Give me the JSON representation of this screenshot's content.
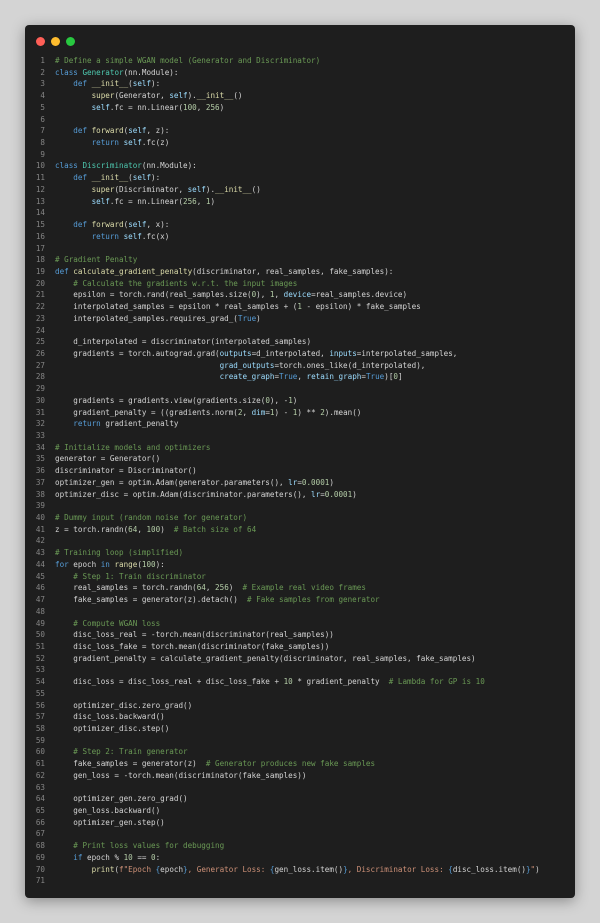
{
  "editor": {
    "colors": {
      "background": "#1e1e1e",
      "keyword": "#569cd6",
      "function": "#dcdcaa",
      "class": "#4ec9b0",
      "self": "#9cdcfe",
      "number": "#b5cea8",
      "string": "#ce9178",
      "comment": "#6a9955",
      "line_number": "#858585",
      "close_dot": "#ff5f57",
      "minimize_dot": "#febc2e",
      "maximize_dot": "#28c840"
    },
    "lines": [
      {
        "n": "1",
        "t": [
          [
            "cm",
            "# Define a simple WGAN model (Generator and Discriminator)"
          ]
        ]
      },
      {
        "n": "2",
        "t": [
          [
            "kw",
            "class "
          ],
          [
            "cls",
            "Generator"
          ],
          [
            "",
            "(nn.Module):"
          ]
        ]
      },
      {
        "n": "3",
        "t": [
          [
            "",
            "    "
          ],
          [
            "kw",
            "def "
          ],
          [
            "fn",
            "__init__"
          ],
          [
            "",
            "("
          ],
          [
            "self",
            "self"
          ],
          [
            "",
            "):"
          ]
        ]
      },
      {
        "n": "4",
        "t": [
          [
            "",
            "        "
          ],
          [
            "fn",
            "super"
          ],
          [
            "",
            "(Generator, "
          ],
          [
            "self",
            "self"
          ],
          [
            "",
            ")."
          ],
          [
            "fn",
            "__init__"
          ],
          [
            "",
            "()"
          ]
        ]
      },
      {
        "n": "5",
        "t": [
          [
            "",
            "        "
          ],
          [
            "self",
            "self"
          ],
          [
            "",
            ".fc = nn.Linear("
          ],
          [
            "num",
            "100"
          ],
          [
            "",
            ", "
          ],
          [
            "num",
            "256"
          ],
          [
            "",
            ")"
          ]
        ]
      },
      {
        "n": "6",
        "t": []
      },
      {
        "n": "7",
        "t": [
          [
            "",
            "    "
          ],
          [
            "kw",
            "def "
          ],
          [
            "fn",
            "forward"
          ],
          [
            "",
            "("
          ],
          [
            "self",
            "self"
          ],
          [
            "",
            ", z):"
          ]
        ]
      },
      {
        "n": "8",
        "t": [
          [
            "",
            "        "
          ],
          [
            "kw",
            "return "
          ],
          [
            "self",
            "self"
          ],
          [
            "",
            ".fc(z)"
          ]
        ]
      },
      {
        "n": "9",
        "t": []
      },
      {
        "n": "10",
        "t": [
          [
            "kw",
            "class "
          ],
          [
            "cls",
            "Discriminator"
          ],
          [
            "",
            "(nn.Module):"
          ]
        ]
      },
      {
        "n": "11",
        "t": [
          [
            "",
            "    "
          ],
          [
            "kw",
            "def "
          ],
          [
            "fn",
            "__init__"
          ],
          [
            "",
            "("
          ],
          [
            "self",
            "self"
          ],
          [
            "",
            "):"
          ]
        ]
      },
      {
        "n": "12",
        "t": [
          [
            "",
            "        "
          ],
          [
            "fn",
            "super"
          ],
          [
            "",
            "(Discriminator, "
          ],
          [
            "self",
            "self"
          ],
          [
            "",
            ")."
          ],
          [
            "fn",
            "__init__"
          ],
          [
            "",
            "()"
          ]
        ]
      },
      {
        "n": "13",
        "t": [
          [
            "",
            "        "
          ],
          [
            "self",
            "self"
          ],
          [
            "",
            ".fc = nn.Linear("
          ],
          [
            "num",
            "256"
          ],
          [
            "",
            ", "
          ],
          [
            "num",
            "1"
          ],
          [
            "",
            ")"
          ]
        ]
      },
      {
        "n": "14",
        "t": []
      },
      {
        "n": "15",
        "t": [
          [
            "",
            "    "
          ],
          [
            "kw",
            "def "
          ],
          [
            "fn",
            "forward"
          ],
          [
            "",
            "("
          ],
          [
            "self",
            "self"
          ],
          [
            "",
            ", x):"
          ]
        ]
      },
      {
        "n": "16",
        "t": [
          [
            "",
            "        "
          ],
          [
            "kw",
            "return "
          ],
          [
            "self",
            "self"
          ],
          [
            "",
            ".fc(x)"
          ]
        ]
      },
      {
        "n": "17",
        "t": []
      },
      {
        "n": "18",
        "t": [
          [
            "cm",
            "# Gradient Penalty"
          ]
        ]
      },
      {
        "n": "19",
        "t": [
          [
            "kw",
            "def "
          ],
          [
            "fn",
            "calculate_gradient_penalty"
          ],
          [
            "",
            "(discriminator, real_samples, fake_samples):"
          ]
        ]
      },
      {
        "n": "20",
        "t": [
          [
            "",
            "    "
          ],
          [
            "cm",
            "# Calculate the gradients w.r.t. the input images"
          ]
        ]
      },
      {
        "n": "21",
        "t": [
          [
            "",
            "    epsilon = torch.rand(real_samples.size("
          ],
          [
            "num",
            "0"
          ],
          [
            "",
            "), "
          ],
          [
            "num",
            "1"
          ],
          [
            "",
            ", "
          ],
          [
            "pm",
            "device"
          ],
          [
            "",
            "=real_samples.device)"
          ]
        ]
      },
      {
        "n": "22",
        "t": [
          [
            "",
            "    interpolated_samples = epsilon * real_samples + ("
          ],
          [
            "num",
            "1"
          ],
          [
            "",
            " - epsilon) * fake_samples"
          ]
        ]
      },
      {
        "n": "23",
        "t": [
          [
            "",
            "    interpolated_samples.requires_grad_("
          ],
          [
            "kw",
            "True"
          ],
          [
            "",
            ")"
          ]
        ]
      },
      {
        "n": "24",
        "t": []
      },
      {
        "n": "25",
        "t": [
          [
            "",
            "    d_interpolated = discriminator(interpolated_samples)"
          ]
        ]
      },
      {
        "n": "26",
        "t": [
          [
            "",
            "    gradients = torch.autograd.grad("
          ],
          [
            "pm",
            "outputs"
          ],
          [
            "",
            "=d_interpolated, "
          ],
          [
            "pm",
            "inputs"
          ],
          [
            "",
            "=interpolated_samples,"
          ]
        ]
      },
      {
        "n": "27",
        "t": [
          [
            "",
            "                                    "
          ],
          [
            "pm",
            "grad_outputs"
          ],
          [
            "",
            "=torch.ones_like(d_interpolated),"
          ]
        ]
      },
      {
        "n": "28",
        "t": [
          [
            "",
            "                                    "
          ],
          [
            "pm",
            "create_graph"
          ],
          [
            "",
            "="
          ],
          [
            "kw",
            "True"
          ],
          [
            "",
            ", "
          ],
          [
            "pm",
            "retain_graph"
          ],
          [
            "",
            "="
          ],
          [
            "kw",
            "True"
          ],
          [
            "",
            ")["
          ],
          [
            "num",
            "0"
          ],
          [
            "",
            "]"
          ]
        ]
      },
      {
        "n": "29",
        "t": []
      },
      {
        "n": "30",
        "t": [
          [
            "",
            "    gradients = gradients.view(gradients.size("
          ],
          [
            "num",
            "0"
          ],
          [
            "",
            "), -"
          ],
          [
            "num",
            "1"
          ],
          [
            "",
            ")"
          ]
        ]
      },
      {
        "n": "31",
        "t": [
          [
            "",
            "    gradient_penalty = ((gradients.norm("
          ],
          [
            "num",
            "2"
          ],
          [
            "",
            ", "
          ],
          [
            "pm",
            "dim"
          ],
          [
            "",
            "="
          ],
          [
            "num",
            "1"
          ],
          [
            "",
            ") - "
          ],
          [
            "num",
            "1"
          ],
          [
            "",
            ") ** "
          ],
          [
            "num",
            "2"
          ],
          [
            "",
            ").mean()"
          ]
        ]
      },
      {
        "n": "32",
        "t": [
          [
            "",
            "    "
          ],
          [
            "kw",
            "return "
          ],
          [
            "",
            "gradient_penalty"
          ]
        ]
      },
      {
        "n": "33",
        "t": []
      },
      {
        "n": "34",
        "t": [
          [
            "cm",
            "# Initialize models and optimizers"
          ]
        ]
      },
      {
        "n": "35",
        "t": [
          [
            "",
            "generator = Generator()"
          ]
        ]
      },
      {
        "n": "36",
        "t": [
          [
            "",
            "discriminator = Discriminator()"
          ]
        ]
      },
      {
        "n": "37",
        "t": [
          [
            "",
            "optimizer_gen = optim.Adam(generator.parameters(), "
          ],
          [
            "pm",
            "lr"
          ],
          [
            "",
            "="
          ],
          [
            "num",
            "0.0001"
          ],
          [
            "",
            ")"
          ]
        ]
      },
      {
        "n": "38",
        "t": [
          [
            "",
            "optimizer_disc = optim.Adam(discriminator.parameters(), "
          ],
          [
            "pm",
            "lr"
          ],
          [
            "",
            "="
          ],
          [
            "num",
            "0.0001"
          ],
          [
            "",
            ")"
          ]
        ]
      },
      {
        "n": "39",
        "t": []
      },
      {
        "n": "40",
        "t": [
          [
            "cm",
            "# Dummy input (random noise for generator)"
          ]
        ]
      },
      {
        "n": "41",
        "t": [
          [
            "",
            "z = torch.randn("
          ],
          [
            "num",
            "64"
          ],
          [
            "",
            ", "
          ],
          [
            "num",
            "100"
          ],
          [
            "",
            ")  "
          ],
          [
            "cm",
            "# Batch size of 64"
          ]
        ]
      },
      {
        "n": "42",
        "t": []
      },
      {
        "n": "43",
        "t": [
          [
            "cm",
            "# Training loop (simplified)"
          ]
        ]
      },
      {
        "n": "44",
        "t": [
          [
            "kw",
            "for "
          ],
          [
            "",
            "epoch "
          ],
          [
            "kw",
            "in "
          ],
          [
            "fn",
            "range"
          ],
          [
            "",
            "("
          ],
          [
            "num",
            "100"
          ],
          [
            "",
            "):"
          ]
        ]
      },
      {
        "n": "45",
        "t": [
          [
            "",
            "    "
          ],
          [
            "cm",
            "# Step 1: Train discriminator"
          ]
        ]
      },
      {
        "n": "46",
        "t": [
          [
            "",
            "    real_samples = torch.randn("
          ],
          [
            "num",
            "64"
          ],
          [
            "",
            ", "
          ],
          [
            "num",
            "256"
          ],
          [
            "",
            ")  "
          ],
          [
            "cm",
            "# Example real video frames"
          ]
        ]
      },
      {
        "n": "47",
        "t": [
          [
            "",
            "    fake_samples = generator(z).detach()  "
          ],
          [
            "cm",
            "# Fake samples from generator"
          ]
        ]
      },
      {
        "n": "48",
        "t": []
      },
      {
        "n": "49",
        "t": [
          [
            "",
            "    "
          ],
          [
            "cm",
            "# Compute WGAN loss"
          ]
        ]
      },
      {
        "n": "50",
        "t": [
          [
            "",
            "    disc_loss_real = -torch.mean(discriminator(real_samples))"
          ]
        ]
      },
      {
        "n": "51",
        "t": [
          [
            "",
            "    disc_loss_fake = torch.mean(discriminator(fake_samples))"
          ]
        ]
      },
      {
        "n": "52",
        "t": [
          [
            "",
            "    gradient_penalty = calculate_gradient_penalty(discriminator, real_samples, fake_samples)"
          ]
        ]
      },
      {
        "n": "53",
        "t": []
      },
      {
        "n": "54",
        "t": [
          [
            "",
            "    disc_loss = disc_loss_real + disc_loss_fake + "
          ],
          [
            "num",
            "10"
          ],
          [
            "",
            " * gradient_penalty  "
          ],
          [
            "cm",
            "# Lambda for GP is 10"
          ]
        ]
      },
      {
        "n": "55",
        "t": []
      },
      {
        "n": "56",
        "t": [
          [
            "",
            "    optimizer_disc.zero_grad()"
          ]
        ]
      },
      {
        "n": "57",
        "t": [
          [
            "",
            "    disc_loss.backward()"
          ]
        ]
      },
      {
        "n": "58",
        "t": [
          [
            "",
            "    optimizer_disc.step()"
          ]
        ]
      },
      {
        "n": "59",
        "t": []
      },
      {
        "n": "60",
        "t": [
          [
            "",
            "    "
          ],
          [
            "cm",
            "# Step 2: Train generator"
          ]
        ]
      },
      {
        "n": "61",
        "t": [
          [
            "",
            "    fake_samples = generator(z)  "
          ],
          [
            "cm",
            "# Generator produces new fake samples"
          ]
        ]
      },
      {
        "n": "62",
        "t": [
          [
            "",
            "    gen_loss = -torch.mean(discriminator(fake_samples))"
          ]
        ]
      },
      {
        "n": "63",
        "t": []
      },
      {
        "n": "64",
        "t": [
          [
            "",
            "    optimizer_gen.zero_grad()"
          ]
        ]
      },
      {
        "n": "65",
        "t": [
          [
            "",
            "    gen_loss.backward()"
          ]
        ]
      },
      {
        "n": "66",
        "t": [
          [
            "",
            "    optimizer_gen.step()"
          ]
        ]
      },
      {
        "n": "67",
        "t": []
      },
      {
        "n": "68",
        "t": [
          [
            "",
            "    "
          ],
          [
            "cm",
            "# Print loss values for debugging"
          ]
        ]
      },
      {
        "n": "69",
        "t": [
          [
            "",
            "    "
          ],
          [
            "kw",
            "if "
          ],
          [
            "",
            "epoch % "
          ],
          [
            "num",
            "10"
          ],
          [
            "",
            " == "
          ],
          [
            "num",
            "0"
          ],
          [
            "",
            ":"
          ]
        ]
      },
      {
        "n": "70",
        "t": [
          [
            "",
            "        "
          ],
          [
            "fn",
            "print"
          ],
          [
            "",
            "("
          ],
          [
            "str",
            "f\"Epoch "
          ],
          [
            "kw",
            "{"
          ],
          [
            "",
            "epoch"
          ],
          [
            "kw",
            "}"
          ],
          [
            "str",
            ", Generator Loss: "
          ],
          [
            "kw",
            "{"
          ],
          [
            "",
            "gen_loss.item()"
          ],
          [
            "kw",
            "}"
          ],
          [
            "str",
            ", Discriminator Loss: "
          ],
          [
            "kw",
            "{"
          ],
          [
            "",
            "disc_loss.item()"
          ],
          [
            "kw",
            "}"
          ],
          [
            "str",
            "\""
          ],
          [
            "",
            ")"
          ]
        ]
      },
      {
        "n": "71",
        "t": []
      }
    ]
  }
}
